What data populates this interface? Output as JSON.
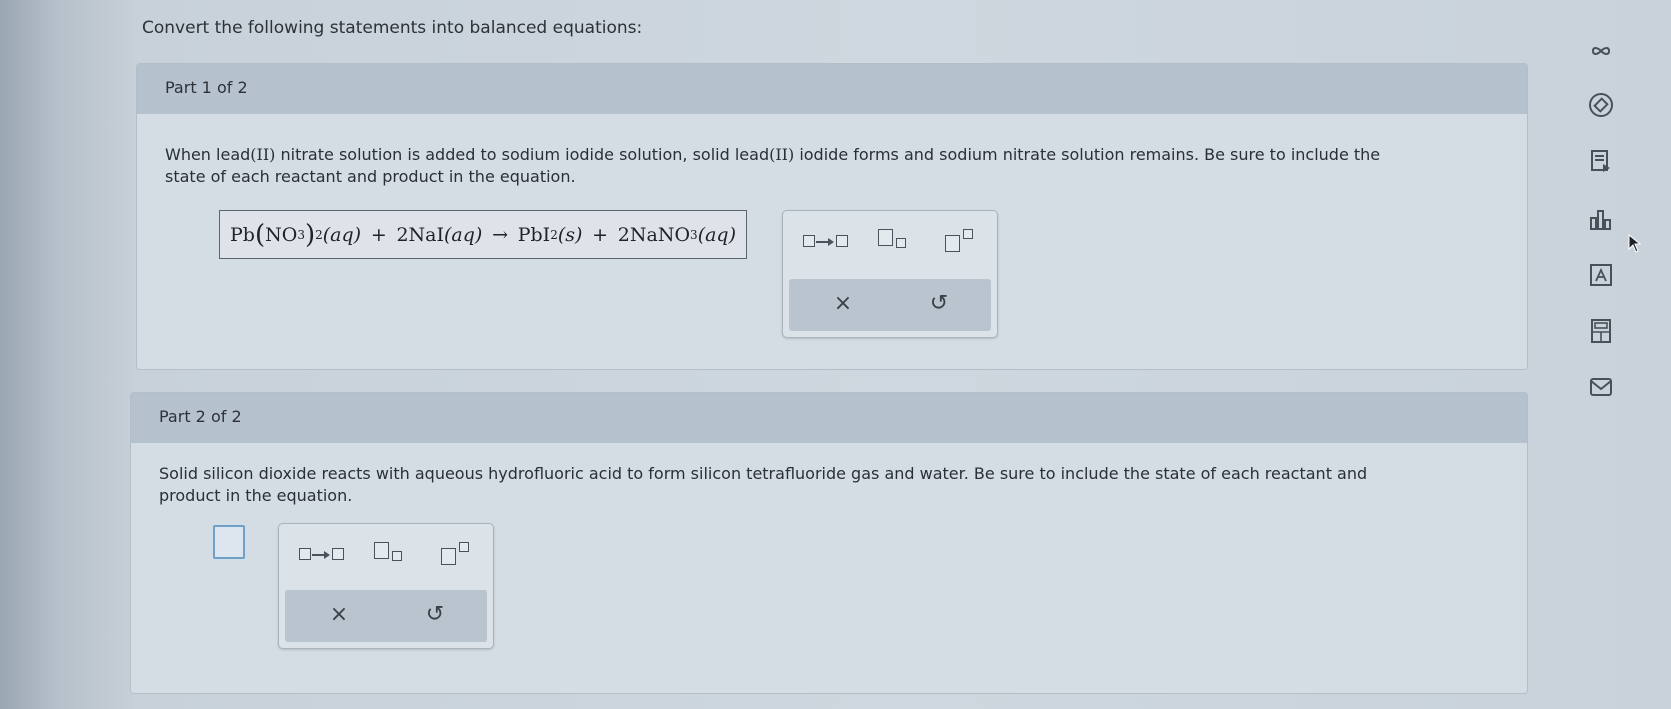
{
  "prompt": "Convert the following statements into balanced equations:",
  "part1": {
    "title": "Part 1 of 2",
    "question_line1_a": "When lead",
    "question_line1_b": "(II)",
    "question_line1_c": " nitrate solution is added to sodium iodide solution, solid lead",
    "question_line1_d": "(II)",
    "question_line1_e": " iodide forms and sodium nitrate solution remains. Be sure to include the",
    "question_line2": "state of each reactant and product in the equation.",
    "answer": {
      "pb": "Pb",
      "no": "NO",
      "sub3": "3",
      "sub2": "2",
      "aq1": "(aq)",
      "plus1": "+",
      "nai": "2NaI",
      "aq2": "(aq)",
      "arrow": "→",
      "pbi": "PbI",
      "sub2b": "2",
      "s": "(s)",
      "plus2": "+",
      "nano": "2NaNO",
      "sub3b": "3",
      "aq3": "(aq)"
    }
  },
  "part2": {
    "title": "Part 2 of 2",
    "question_line1": "Solid silicon dioxide reacts with aqueous hydrofluoric acid to form silicon tetrafluoride gas and water. Be sure to include the state of each reactant and",
    "question_line2": "product in the equation."
  },
  "palette": {
    "clear_glyph": "×",
    "undo_glyph": "↺"
  },
  "rail_icons": [
    "infinity-icon",
    "eraser-icon",
    "text-reader-icon",
    "bar-chart-icon",
    "periodic-table-icon",
    "calculator-icon",
    "mail-icon"
  ],
  "colors": {
    "header_band": "#b5c1cd",
    "input_border_active": "#6fa0c8"
  }
}
